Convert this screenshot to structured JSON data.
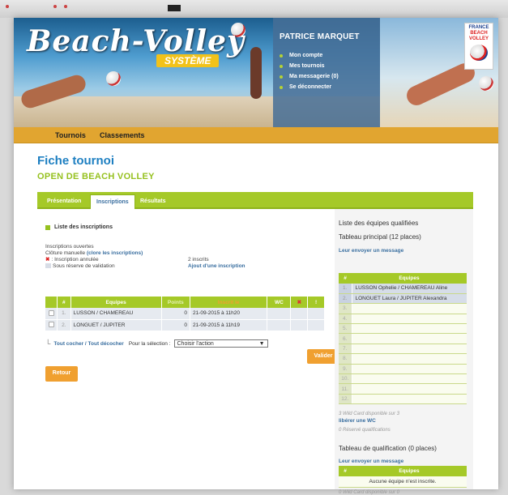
{
  "banner": {
    "logo_main": "Beach-Volley",
    "logo_sub": "SYSTÈME",
    "user_name": "PATRICE MARQUET",
    "user_menu": [
      "Mon compte",
      "Mes tournois",
      "Ma messagerie (0)",
      "Se déconnecter"
    ],
    "ffvb": {
      "line1": "FRANCE",
      "line2": "BEACH",
      "line3": "VOLLEY"
    }
  },
  "nav": {
    "items": [
      "Tournois",
      "Classements"
    ]
  },
  "page": {
    "title": "Fiche tournoi",
    "subtitle": "OPEN DE BEACH VOLLEY"
  },
  "tabs": [
    "Présentation",
    "Inscriptions",
    "Résultats"
  ],
  "inscriptions": {
    "section_title": "Liste des inscriptions",
    "status": "Inscriptions ouvertes",
    "closure_prefix": "Clôture manuelle",
    "closure_link": "(clore les inscriptions)",
    "legend_cancelled": ": Inscription annulée",
    "legend_reserve": "Sous réserve de validation",
    "count": "2 inscrits",
    "add_link": "Ajout d'une inscription",
    "columns": [
      "#",
      "Equipes",
      "Points",
      "Inscrit le",
      "WC",
      "✖",
      "!"
    ],
    "rows": [
      {
        "num": "1.",
        "team": "LUSSON / CHAMEREAU",
        "points": "0",
        "date": "21-09-2015 à 11h20"
      },
      {
        "num": "2.",
        "team": "LONGUET / JUPITER",
        "points": "0",
        "date": "21-09-2015 à 11h19"
      }
    ],
    "check_all": "Tout cocher / Tout décocher",
    "selection_label": "Pour la sélection :",
    "action_select": "Choisir l'action",
    "validate": "Valider",
    "back": "Retour"
  },
  "sidebar": {
    "title": "Liste des équipes qualifiées",
    "main_table_title": "Tableau principal (12 places)",
    "send_message": "Leur envoyer un message",
    "main_columns": [
      "#",
      "Equipes"
    ],
    "main_rows": [
      {
        "num": "1.",
        "team": "LUSSON Ophelie / CHAMEREAU Aline"
      },
      {
        "num": "2.",
        "team": "LONGUET Laura / JUPITER Alexandra"
      },
      {
        "num": "3.",
        "team": ""
      },
      {
        "num": "4.",
        "team": ""
      },
      {
        "num": "5.",
        "team": ""
      },
      {
        "num": "6.",
        "team": ""
      },
      {
        "num": "7.",
        "team": ""
      },
      {
        "num": "8.",
        "team": ""
      },
      {
        "num": "9.",
        "team": ""
      },
      {
        "num": "10.",
        "team": ""
      },
      {
        "num": "11.",
        "team": ""
      },
      {
        "num": "12.",
        "team": ""
      }
    ],
    "wc_available": "3 Wild Card disponible sur 3",
    "free_wc": "libérer une WC",
    "reserve_note": "0 Réservé qualifications",
    "qual_title": "Tableau de qualification (0 places)",
    "qual_send_message": "Leur envoyer un message",
    "qual_columns": [
      "#",
      "Equipes"
    ],
    "qual_empty": "Aucune équipe n'est inscrite.",
    "qual_wc": "0 Wild Card disponible sur 0"
  }
}
